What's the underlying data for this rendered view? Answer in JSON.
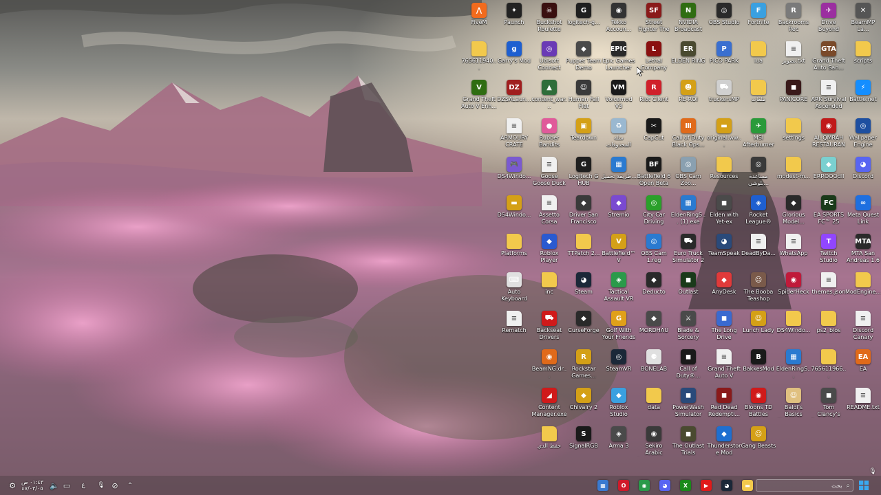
{
  "desktop_icons": [
    {
      "label": "FiveM",
      "glyph": "⋀",
      "color": "#f26b1d"
    },
    {
      "label": "Paunch",
      "glyph": "✦",
      "color": "#222222"
    },
    {
      "label": "Buckshot Roulette",
      "glyph": "☠",
      "color": "#3a1010"
    },
    {
      "label": "logitech-g...",
      "glyph": "G",
      "color": "#1f1f1f"
    },
    {
      "label": "Tekko Accoun...",
      "glyph": "◉",
      "color": "#333333"
    },
    {
      "label": "Street Fighter The Game",
      "glyph": "SF",
      "color": "#8a1a1a"
    },
    {
      "label": "NVIDIA Broadcast",
      "glyph": "N",
      "color": "#2f6d12"
    },
    {
      "label": "OBS Studio",
      "glyph": "◎",
      "color": "#2a2a2a"
    },
    {
      "label": "Fortnite",
      "glyph": "F",
      "color": "#3aa0e0"
    },
    {
      "label": "Backrooms Rec",
      "glyph": "R",
      "color": "#7a7a7a"
    },
    {
      "label": "Drive Beyond Horizons",
      "glyph": "✈",
      "color": "#9b2fa0"
    },
    {
      "label": "BeamMP La...",
      "glyph": "✕",
      "color": "#555555"
    },
    {
      "label": "765611940...",
      "glyph": "",
      "color": "#f2c94c",
      "type": "folder"
    },
    {
      "label": "Garry's Mod",
      "glyph": "g",
      "color": "#1e5fd0"
    },
    {
      "label": "Ubisoft Connect",
      "glyph": "◎",
      "color": "#6a3ab5"
    },
    {
      "label": "Puppet Team Demo",
      "glyph": "◆",
      "color": "#4a4a4a"
    },
    {
      "label": "Epic Games Launcher",
      "glyph": "EPIC",
      "color": "#2a2a2a"
    },
    {
      "label": "Lethal Company",
      "glyph": "L",
      "color": "#8a1010"
    },
    {
      "label": "ELDEN RING",
      "glyph": "ER",
      "color": "#4a4a30"
    },
    {
      "label": "PICO PARK",
      "glyph": "P",
      "color": "#3a6fd0"
    },
    {
      "label": "lua",
      "glyph": "",
      "color": "#f2c94c",
      "type": "folder"
    },
    {
      "label": "تصوير.txt",
      "glyph": "≡",
      "color": "#f0f0f0",
      "type": "file"
    },
    {
      "label": "Grand Theft Auto San...",
      "glyph": "GTA",
      "color": "#7a4a2a"
    },
    {
      "label": "scripts",
      "glyph": "",
      "color": "#f2c94c",
      "type": "folder"
    },
    {
      "label": "Grand Theft Auto V Enh...",
      "glyph": "V",
      "color": "#2f6d12"
    },
    {
      "label": "DZSALaun...",
      "glyph": "DZ",
      "color": "#a01f1f"
    },
    {
      "label": "content_war...",
      "glyph": "▲",
      "color": "#2f6d3a"
    },
    {
      "label": "Human Fall Flat",
      "glyph": "☺",
      "color": "#3a3a3a"
    },
    {
      "label": "Voicemod V3",
      "glyph": "VM",
      "color": "#1a1a1a"
    },
    {
      "label": "Riot Client",
      "glyph": "R",
      "color": "#d0202a"
    },
    {
      "label": "RE-ROI",
      "glyph": "☻",
      "color": "#d4a017"
    },
    {
      "label": "truckersMP",
      "glyph": "⛟",
      "color": "#d0d0d0"
    },
    {
      "label": "ملفات",
      "glyph": "",
      "color": "#f2c94c",
      "type": "folder"
    },
    {
      "label": "PANICORE",
      "glyph": "◼",
      "color": "#3a1a1a"
    },
    {
      "label": "ARK Survival Ascended",
      "glyph": "≡",
      "color": "#f0f0f0",
      "type": "file"
    },
    {
      "label": "Battle.net",
      "glyph": "⚡",
      "color": "#148eff"
    },
    {
      "label": "ARMOURY CRATE",
      "glyph": "≡",
      "color": "#f0f0f0",
      "type": "file"
    },
    {
      "label": "Rubber Bandits",
      "glyph": "●",
      "color": "#e05a9a"
    },
    {
      "label": "Teardown",
      "glyph": "▣",
      "color": "#d4a017"
    },
    {
      "label": "سلة المحذوفات",
      "glyph": "♻",
      "color": "#9ab8d0"
    },
    {
      "label": "CapCut",
      "glyph": "✂",
      "color": "#1a1a1a"
    },
    {
      "label": "Call of Duty Black Ops...",
      "glyph": "Ⅲ",
      "color": "#e06a1a"
    },
    {
      "label": "original.ww...",
      "glyph": "▬",
      "color": "#d4a017"
    },
    {
      "label": "MSI Afterburner",
      "glyph": "✈",
      "color": "#2a9a3a"
    },
    {
      "label": "settings",
      "glyph": "",
      "color": "#f2c94c",
      "type": "folder"
    },
    {
      "label": "AL QMRAH RESTAURANT",
      "glyph": "◉",
      "color": "#c01a1a"
    },
    {
      "label": "Wallpaper Engine",
      "glyph": "◎",
      "color": "#1e4fa0"
    },
    {
      "label": "DS4Windo...",
      "glyph": "🎮",
      "color": "#7a5ad0"
    },
    {
      "label": "Goose Goose Duck",
      "glyph": "≡",
      "color": "#f0f0f0",
      "type": "file"
    },
    {
      "label": "Logitech G HUB",
      "glyph": "G",
      "color": "#1f1f1f"
    },
    {
      "label": "طريقة تحميل...",
      "glyph": "▦",
      "color": "#2a7ad0"
    },
    {
      "label": "Battlefield 6 Open Beta",
      "glyph": "BF",
      "color": "#1a1a1a"
    },
    {
      "label": "OBS Cam Zoo...",
      "glyph": "◎",
      "color": "#8aa0b0"
    },
    {
      "label": "Resources",
      "glyph": "",
      "color": "#f2c94c",
      "type": "folder"
    },
    {
      "label": "مساعدة بلوشي...",
      "glyph": "◎",
      "color": "#3a3a3a"
    },
    {
      "label": "modest-m...",
      "glyph": "",
      "color": "#f2c94c",
      "type": "folder"
    },
    {
      "label": "ERROOOdll",
      "glyph": "◆",
      "color": "#7ad0d0"
    },
    {
      "label": "Discord",
      "glyph": "◕",
      "color": "#5865f2"
    },
    {
      "label": "DS4Windo...",
      "glyph": "▬",
      "color": "#d4a017"
    },
    {
      "label": "Assetto Corsa",
      "glyph": "≡",
      "color": "#f0f0f0",
      "type": "file"
    },
    {
      "label": "Driver San Francisco",
      "glyph": "◆",
      "color": "#3a3a3a"
    },
    {
      "label": "Stremio",
      "glyph": "◆",
      "color": "#7a4ad0"
    },
    {
      "label": "City Car Driving",
      "glyph": "◎",
      "color": "#2aa02a"
    },
    {
      "label": "EldenRingS... (1).exe",
      "glyph": "▦",
      "color": "#2a7ad0"
    },
    {
      "label": "Elden with Yet-ex",
      "glyph": "◼",
      "color": "#4a4a4a"
    },
    {
      "label": "Rocket League®",
      "glyph": "◈",
      "color": "#1e5fd0"
    },
    {
      "label": "Glorious Model...",
      "glyph": "◆",
      "color": "#2a2a2a"
    },
    {
      "label": "EA SPORTS FC™ 25",
      "glyph": "FC",
      "color": "#1a3a1a"
    },
    {
      "label": "Meta Quest Link",
      "glyph": "∞",
      "color": "#1e6fe0"
    },
    {
      "label": "Platforms",
      "glyph": "",
      "color": "#f2c94c",
      "type": "folder"
    },
    {
      "label": "Roblox Player",
      "glyph": "◆",
      "color": "#2a5ad0"
    },
    {
      "label": "TTPatch 2...",
      "glyph": "",
      "color": "#f2c94c",
      "type": "folder"
    },
    {
      "label": "Battlefield™ V",
      "glyph": "V",
      "color": "#d4a017"
    },
    {
      "label": "OBS Cam 1.reg",
      "glyph": "◎",
      "color": "#2a7ad0"
    },
    {
      "label": "Euro Truck Simulator 2",
      "glyph": "⛟",
      "color": "#2a2a2a"
    },
    {
      "label": "TeamSpeak",
      "glyph": "◕",
      "color": "#2a4a7a"
    },
    {
      "label": "DeadByDa...",
      "glyph": "≡",
      "color": "#f0f0f0",
      "type": "file"
    },
    {
      "label": "WhatsApp",
      "glyph": "≡",
      "color": "#f0f0f0",
      "type": "file"
    },
    {
      "label": "Twitch Studio",
      "glyph": "T",
      "color": "#9146ff"
    },
    {
      "label": "MTA San Andreas 1.6",
      "glyph": "MTA",
      "color": "#2a2a2a"
    },
    {
      "label": "Auto Keyboard",
      "glyph": "⌨",
      "color": "#e0e0e0"
    },
    {
      "label": "inc",
      "glyph": "",
      "color": "#f2c94c",
      "type": "folder"
    },
    {
      "label": "Steam",
      "glyph": "◕",
      "color": "#1b2838"
    },
    {
      "label": "Tactical Assault VR",
      "glyph": "◈",
      "color": "#2a9a4a"
    },
    {
      "label": "Deducto",
      "glyph": "◆",
      "color": "#2a2a2a"
    },
    {
      "label": "Outlast",
      "glyph": "◼",
      "color": "#1a3a1a"
    },
    {
      "label": "AnyDesk",
      "glyph": "◆",
      "color": "#e03a3a"
    },
    {
      "label": "The Booba Teashop",
      "glyph": "☺",
      "color": "#7a5a4a"
    },
    {
      "label": "SpiderHeck",
      "glyph": "◉",
      "color": "#c01a3a"
    },
    {
      "label": "themes.json",
      "glyph": "≡",
      "color": "#f0f0f0",
      "type": "file"
    },
    {
      "label": "ModEngine...",
      "glyph": "",
      "color": "#f2c94c",
      "type": "folder"
    },
    {
      "label": "Rematch",
      "glyph": "≡",
      "color": "#f0f0f0",
      "type": "file"
    },
    {
      "label": "Backseat Drivers Demo",
      "glyph": "⛟",
      "color": "#d01a1a"
    },
    {
      "label": "CurseForge",
      "glyph": "◆",
      "color": "#2a2a2a"
    },
    {
      "label": "Golf With Your Friends",
      "glyph": "G",
      "color": "#e0a01a"
    },
    {
      "label": "MORDHAU",
      "glyph": "◆",
      "color": "#4a4a4a"
    },
    {
      "label": "Blade & Sorcery",
      "glyph": "⚔",
      "color": "#4a4a4a"
    },
    {
      "label": "The Long Drive",
      "glyph": "◼",
      "color": "#3a6ad0"
    },
    {
      "label": "Lunch Lady",
      "glyph": "☺",
      "color": "#d4a017"
    },
    {
      "label": "DS4Windo...",
      "glyph": "",
      "color": "#f2c94c",
      "type": "folder"
    },
    {
      "label": "ps2_bios",
      "glyph": "",
      "color": "#f2c94c",
      "type": "folder"
    },
    {
      "label": "Discord Canary",
      "glyph": "≡",
      "color": "#f0f0f0",
      "type": "file"
    },
    {
      "label": "BeamNG.dr...",
      "glyph": "◉",
      "color": "#e06a1a"
    },
    {
      "label": "Rockstar Games...",
      "glyph": "R",
      "color": "#d4a017"
    },
    {
      "label": "SteamVR",
      "glyph": "◎",
      "color": "#1b2838"
    },
    {
      "label": "BONELAB",
      "glyph": "⚈",
      "color": "#e0e0e0"
    },
    {
      "label": "Call of Duty®...",
      "glyph": "◼",
      "color": "#1a1a1a"
    },
    {
      "label": "Grand Theft Auto V",
      "glyph": "≡",
      "color": "#f0f0f0",
      "type": "file"
    },
    {
      "label": "BakkesMod",
      "glyph": "B",
      "color": "#1a1a1a"
    },
    {
      "label": "EldenRingS...",
      "glyph": "▦",
      "color": "#2a7ad0"
    },
    {
      "label": "765611966...",
      "glyph": "",
      "color": "#f2c94c",
      "type": "folder"
    },
    {
      "label": "EA",
      "glyph": "EA",
      "color": "#e06a1a"
    },
    {
      "label": "Content Manager.exe",
      "glyph": "◢",
      "color": "#d01a1a"
    },
    {
      "label": "Chivalry 2",
      "glyph": "◆",
      "color": "#d4a017"
    },
    {
      "label": "Roblox Studio",
      "glyph": "◆",
      "color": "#3aa0e0"
    },
    {
      "label": "data",
      "glyph": "",
      "color": "#f2c94c",
      "type": "folder"
    },
    {
      "label": "PowerWash Simulator",
      "glyph": "◼",
      "color": "#2a4a7a"
    },
    {
      "label": "Red Dead Redempti...",
      "glyph": "◼",
      "color": "#8a1a1a"
    },
    {
      "label": "Bloons TD Battles",
      "glyph": "◉",
      "color": "#d01a1a"
    },
    {
      "label": "Baldi's Basics Classic Re...",
      "glyph": "☺",
      "color": "#e0c080"
    },
    {
      "label": "Tom Clancy's Rainbow Si...",
      "glyph": "◼",
      "color": "#4a4a4a"
    },
    {
      "label": "README.txt",
      "glyph": "≡",
      "color": "#f0f0f0",
      "type": "file"
    },
    {
      "label": "حفظ الدي",
      "glyph": "",
      "color": "#f2c94c",
      "type": "folder"
    },
    {
      "label": "SignalRGB",
      "glyph": "S",
      "color": "#1a1a1a"
    },
    {
      "label": "Arma 3",
      "glyph": "◈",
      "color": "#4a4a4a"
    },
    {
      "label": "Sekiro Arabic Localisation",
      "glyph": "◉",
      "color": "#3a3a3a"
    },
    {
      "label": "The Outlast Trials",
      "glyph": "◼",
      "color": "#4a4a30"
    },
    {
      "label": "Thunderstore Mod Mana...",
      "glyph": "◆",
      "color": "#1e6fd0"
    },
    {
      "label": "Gang Beasts",
      "glyph": "☺",
      "color": "#d4a017"
    }
  ],
  "taskbar": {
    "clock_time": "٠١:٤٣ ص",
    "clock_date": "٤٧/٠٣/٠٥",
    "search_placeholder": "بحث",
    "language": "ع",
    "apps": [
      {
        "name": "tb-app-explorer-icon",
        "glyph": "▦",
        "color": "#3a7ad0"
      },
      {
        "name": "tb-app-opera-icon",
        "glyph": "O",
        "color": "#d01a2a"
      },
      {
        "name": "tb-app-chrome-icon",
        "glyph": "◉",
        "color": "#2a9a4a"
      },
      {
        "name": "tb-app-discord-icon",
        "glyph": "◕",
        "color": "#5865f2"
      },
      {
        "name": "tb-app-xbox-icon",
        "glyph": "X",
        "color": "#1a8a1a"
      },
      {
        "name": "tb-app-youtube-icon",
        "glyph": "▶",
        "color": "#e01a1a"
      },
      {
        "name": "tb-app-steam-icon",
        "glyph": "◕",
        "color": "#1b2838"
      },
      {
        "name": "tb-app-folder-icon",
        "glyph": "▬",
        "color": "#f2c94c"
      }
    ]
  }
}
